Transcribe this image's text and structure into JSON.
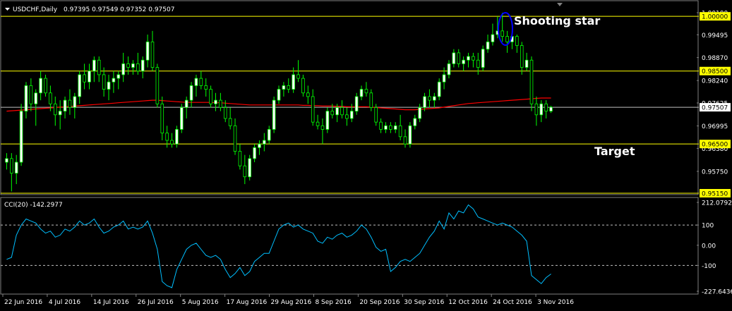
{
  "header": {
    "symbol": "USDCHF,Daily",
    "ohlc": "0.97395 0.97549 0.97352 0.97507",
    "menu_icon": "triangle-down-icon"
  },
  "colors": {
    "background": "#000000",
    "bull_candle": "#ffffff",
    "bear_candle": "#000000",
    "candle_outline": "#00ff00",
    "ma_line": "#ff0000",
    "hline": "#ffff00",
    "bid_line": "#c0c0c0",
    "cci_line": "#00bfff",
    "annotation_ellipse": "#0000ff"
  },
  "annotations": {
    "shooting_star": "Shooting star",
    "target": "Target"
  },
  "indicator": {
    "label": "CCI(20) -142.2977"
  },
  "chart_data": [
    {
      "type": "candlestick",
      "ylim": [
        0.9515,
        1.001
      ],
      "yticks": [
        "1.00100",
        "0.99495",
        "0.98870",
        "0.98240",
        "0.97625",
        "0.96995",
        "0.96380",
        "0.95750"
      ],
      "hlines": [
        {
          "value": 1.0,
          "label": "1.00000"
        },
        {
          "value": 0.985,
          "label": "0.98500"
        },
        {
          "value": 0.965,
          "label": "0.96500"
        },
        {
          "value": 0.9515,
          "label": "0.95150"
        }
      ],
      "current_price": {
        "value": 0.97507,
        "label": "0.97507"
      },
      "xticks": [
        "22 Jun 2016",
        "4 Jul 2016",
        "14 Jul 2016",
        "26 Jul 2016",
        "5 Aug 2016",
        "17 Aug 2016",
        "29 Aug 2016",
        "8 Sep 2016",
        "20 Sep 2016",
        "30 Sep 2016",
        "12 Oct 2016",
        "24 Oct 2016",
        "3 Nov 2016"
      ],
      "candles": [
        [
          0.96,
          0.9625,
          0.958,
          0.961
        ],
        [
          0.961,
          0.9625,
          0.952,
          0.957
        ],
        [
          0.957,
          0.962,
          0.954,
          0.96
        ],
        [
          0.96,
          0.976,
          0.959,
          0.974
        ],
        [
          0.974,
          0.982,
          0.972,
          0.981
        ],
        [
          0.981,
          0.983,
          0.974,
          0.976
        ],
        [
          0.976,
          0.98,
          0.97,
          0.979
        ],
        [
          0.979,
          0.985,
          0.977,
          0.983
        ],
        [
          0.983,
          0.984,
          0.978,
          0.979
        ],
        [
          0.979,
          0.981,
          0.974,
          0.976
        ],
        [
          0.976,
          0.978,
          0.97,
          0.973
        ],
        [
          0.973,
          0.977,
          0.969,
          0.974
        ],
        [
          0.974,
          0.978,
          0.972,
          0.977
        ],
        [
          0.977,
          0.98,
          0.973,
          0.975
        ],
        [
          0.975,
          0.979,
          0.972,
          0.978
        ],
        [
          0.978,
          0.985,
          0.976,
          0.984
        ],
        [
          0.984,
          0.987,
          0.98,
          0.982
        ],
        [
          0.982,
          0.987,
          0.98,
          0.985
        ],
        [
          0.985,
          0.989,
          0.982,
          0.988
        ],
        [
          0.988,
          0.989,
          0.982,
          0.984
        ],
        [
          0.984,
          0.986,
          0.978,
          0.98
        ],
        [
          0.98,
          0.984,
          0.977,
          0.982
        ],
        [
          0.982,
          0.985,
          0.979,
          0.983
        ],
        [
          0.983,
          0.985,
          0.98,
          0.984
        ],
        [
          0.984,
          0.99,
          0.982,
          0.987
        ],
        [
          0.987,
          0.989,
          0.984,
          0.986
        ],
        [
          0.986,
          0.988,
          0.984,
          0.987
        ],
        [
          0.987,
          0.99,
          0.984,
          0.985
        ],
        [
          0.985,
          0.989,
          0.983,
          0.988
        ],
        [
          0.988,
          0.995,
          0.986,
          0.993
        ],
        [
          0.993,
          0.996,
          0.985,
          0.986
        ],
        [
          0.986,
          0.987,
          0.975,
          0.976
        ],
        [
          0.976,
          0.978,
          0.966,
          0.968
        ],
        [
          0.968,
          0.97,
          0.964,
          0.966
        ],
        [
          0.966,
          0.968,
          0.964,
          0.965
        ],
        [
          0.965,
          0.97,
          0.964,
          0.969
        ],
        [
          0.969,
          0.976,
          0.968,
          0.975
        ],
        [
          0.975,
          0.978,
          0.972,
          0.977
        ],
        [
          0.977,
          0.982,
          0.975,
          0.981
        ],
        [
          0.981,
          0.984,
          0.978,
          0.983
        ],
        [
          0.983,
          0.985,
          0.98,
          0.981
        ],
        [
          0.981,
          0.983,
          0.978,
          0.98
        ],
        [
          0.98,
          0.981,
          0.975,
          0.976
        ],
        [
          0.976,
          0.979,
          0.974,
          0.977
        ],
        [
          0.977,
          0.979,
          0.974,
          0.975
        ],
        [
          0.975,
          0.977,
          0.971,
          0.972
        ],
        [
          0.972,
          0.975,
          0.969,
          0.97
        ],
        [
          0.97,
          0.972,
          0.962,
          0.963
        ],
        [
          0.963,
          0.965,
          0.958,
          0.959
        ],
        [
          0.959,
          0.962,
          0.954,
          0.956
        ],
        [
          0.956,
          0.962,
          0.955,
          0.961
        ],
        [
          0.961,
          0.965,
          0.96,
          0.964
        ],
        [
          0.964,
          0.966,
          0.962,
          0.965
        ],
        [
          0.965,
          0.968,
          0.963,
          0.966
        ],
        [
          0.966,
          0.97,
          0.965,
          0.969
        ],
        [
          0.969,
          0.978,
          0.968,
          0.977
        ],
        [
          0.977,
          0.981,
          0.976,
          0.98
        ],
        [
          0.98,
          0.982,
          0.978,
          0.981
        ],
        [
          0.981,
          0.983,
          0.979,
          0.98
        ],
        [
          0.98,
          0.986,
          0.979,
          0.984
        ],
        [
          0.984,
          0.988,
          0.982,
          0.983
        ],
        [
          0.983,
          0.984,
          0.978,
          0.979
        ],
        [
          0.979,
          0.981,
          0.976,
          0.978
        ],
        [
          0.978,
          0.98,
          0.97,
          0.971
        ],
        [
          0.971,
          0.973,
          0.969,
          0.97
        ],
        [
          0.97,
          0.972,
          0.965,
          0.969
        ],
        [
          0.969,
          0.975,
          0.968,
          0.974
        ],
        [
          0.974,
          0.976,
          0.972,
          0.973
        ],
        [
          0.973,
          0.976,
          0.971,
          0.975
        ],
        [
          0.975,
          0.977,
          0.972,
          0.973
        ],
        [
          0.973,
          0.975,
          0.97,
          0.972
        ],
        [
          0.972,
          0.976,
          0.971,
          0.974
        ],
        [
          0.974,
          0.979,
          0.973,
          0.978
        ],
        [
          0.978,
          0.981,
          0.977,
          0.98
        ],
        [
          0.98,
          0.982,
          0.978,
          0.979
        ],
        [
          0.979,
          0.98,
          0.974,
          0.975
        ],
        [
          0.975,
          0.976,
          0.97,
          0.971
        ],
        [
          0.971,
          0.972,
          0.968,
          0.969
        ],
        [
          0.969,
          0.971,
          0.968,
          0.97
        ],
        [
          0.97,
          0.971,
          0.968,
          0.969
        ],
        [
          0.969,
          0.971,
          0.968,
          0.97
        ],
        [
          0.97,
          0.973,
          0.966,
          0.967
        ],
        [
          0.967,
          0.969,
          0.964,
          0.965
        ],
        [
          0.965,
          0.971,
          0.964,
          0.97
        ],
        [
          0.97,
          0.973,
          0.969,
          0.972
        ],
        [
          0.972,
          0.976,
          0.971,
          0.975
        ],
        [
          0.975,
          0.979,
          0.974,
          0.978
        ],
        [
          0.978,
          0.98,
          0.975,
          0.977
        ],
        [
          0.977,
          0.979,
          0.975,
          0.978
        ],
        [
          0.978,
          0.983,
          0.977,
          0.982
        ],
        [
          0.982,
          0.986,
          0.98,
          0.984
        ],
        [
          0.984,
          0.988,
          0.983,
          0.987
        ],
        [
          0.987,
          0.991,
          0.986,
          0.99
        ],
        [
          0.99,
          0.991,
          0.986,
          0.987
        ],
        [
          0.987,
          0.989,
          0.985,
          0.988
        ],
        [
          0.988,
          0.99,
          0.986,
          0.989
        ],
        [
          0.989,
          0.99,
          0.986,
          0.988
        ],
        [
          0.988,
          0.99,
          0.984,
          0.986
        ],
        [
          0.986,
          0.992,
          0.985,
          0.991
        ],
        [
          0.991,
          0.995,
          0.99,
          0.993
        ],
        [
          0.993,
          0.998,
          0.992,
          0.995
        ],
        [
          0.995,
          1.0,
          0.994,
          0.996
        ],
        [
          0.996,
          1.001,
          0.993,
          0.9945
        ],
        [
          0.9945,
          0.996,
          0.99,
          0.993
        ],
        [
          0.993,
          0.996,
          0.991,
          0.9945
        ],
        [
          0.9945,
          0.995,
          0.99,
          0.992
        ],
        [
          0.992,
          0.993,
          0.984,
          0.986
        ],
        [
          0.986,
          0.99,
          0.985,
          0.988
        ],
        [
          0.988,
          0.989,
          0.974,
          0.976
        ],
        [
          0.976,
          0.978,
          0.97,
          0.973
        ],
        [
          0.973,
          0.977,
          0.971,
          0.976
        ],
        [
          0.976,
          0.977,
          0.972,
          0.974
        ],
        [
          0.974,
          0.9755,
          0.9735,
          0.9751
        ]
      ],
      "ma": [
        0.974,
        0.9741,
        0.9742,
        0.9743,
        0.9744,
        0.9745,
        0.9746,
        0.9747,
        0.9748,
        0.9749,
        0.975,
        0.9751,
        0.9752,
        0.9753,
        0.9754,
        0.9755,
        0.9756,
        0.9757,
        0.9758,
        0.9759,
        0.976,
        0.9761,
        0.9762,
        0.9763,
        0.9764,
        0.9765,
        0.9766,
        0.9767,
        0.9768,
        0.9769,
        0.977,
        0.977,
        0.9769,
        0.9768,
        0.9767,
        0.9766,
        0.9765,
        0.9764,
        0.9764,
        0.9764,
        0.9764,
        0.9764,
        0.9764,
        0.9763,
        0.9763,
        0.9762,
        0.9761,
        0.976,
        0.9759,
        0.9758,
        0.9757,
        0.9757,
        0.9757,
        0.9757,
        0.9757,
        0.9757,
        0.9757,
        0.9757,
        0.9757,
        0.9757,
        0.9757,
        0.9756,
        0.9756,
        0.9755,
        0.9755,
        0.9754,
        0.9754,
        0.9754,
        0.9753,
        0.9753,
        0.9752,
        0.9752,
        0.9752,
        0.9752,
        0.9752,
        0.9751,
        0.975,
        0.9749,
        0.9748,
        0.9747,
        0.9746,
        0.9745,
        0.9744,
        0.9744,
        0.9744,
        0.9745,
        0.9746,
        0.9747,
        0.9748,
        0.9749,
        0.9751,
        0.9753,
        0.9755,
        0.9757,
        0.9759,
        0.9761,
        0.9762,
        0.9763,
        0.9764,
        0.9765,
        0.9766,
        0.9767,
        0.9768,
        0.9769,
        0.977,
        0.9771,
        0.9772,
        0.9773,
        0.9774,
        0.9775,
        0.9776,
        0.9776,
        0.9776
      ]
    },
    {
      "type": "line",
      "name": "CCI(20)",
      "ylim": [
        -227.6436,
        212.0792
      ],
      "yticks": [
        "212.0792",
        "100",
        "0.00",
        "-100",
        "-227.6436"
      ],
      "levels": [
        100,
        -100
      ],
      "values": [
        -70,
        -60,
        50,
        100,
        130,
        120,
        110,
        80,
        60,
        70,
        40,
        50,
        80,
        70,
        90,
        120,
        100,
        110,
        130,
        90,
        60,
        70,
        90,
        100,
        120,
        80,
        90,
        80,
        90,
        120,
        60,
        -20,
        -180,
        -200,
        -210,
        -120,
        -70,
        -20,
        0,
        10,
        -20,
        -50,
        -60,
        -50,
        -70,
        -120,
        -160,
        -140,
        -110,
        -150,
        -130,
        -80,
        -60,
        -40,
        -40,
        20,
        80,
        100,
        110,
        90,
        100,
        80,
        70,
        60,
        20,
        10,
        40,
        30,
        50,
        60,
        40,
        50,
        70,
        100,
        80,
        40,
        -10,
        -30,
        -20,
        -130,
        -110,
        -80,
        -70,
        -80,
        -60,
        -40,
        0,
        40,
        70,
        120,
        80,
        160,
        130,
        170,
        160,
        200,
        180,
        140,
        130,
        120,
        110,
        100,
        110,
        100,
        90,
        70,
        50,
        20,
        -150,
        -170,
        -190,
        -160,
        -142
      ]
    }
  ]
}
